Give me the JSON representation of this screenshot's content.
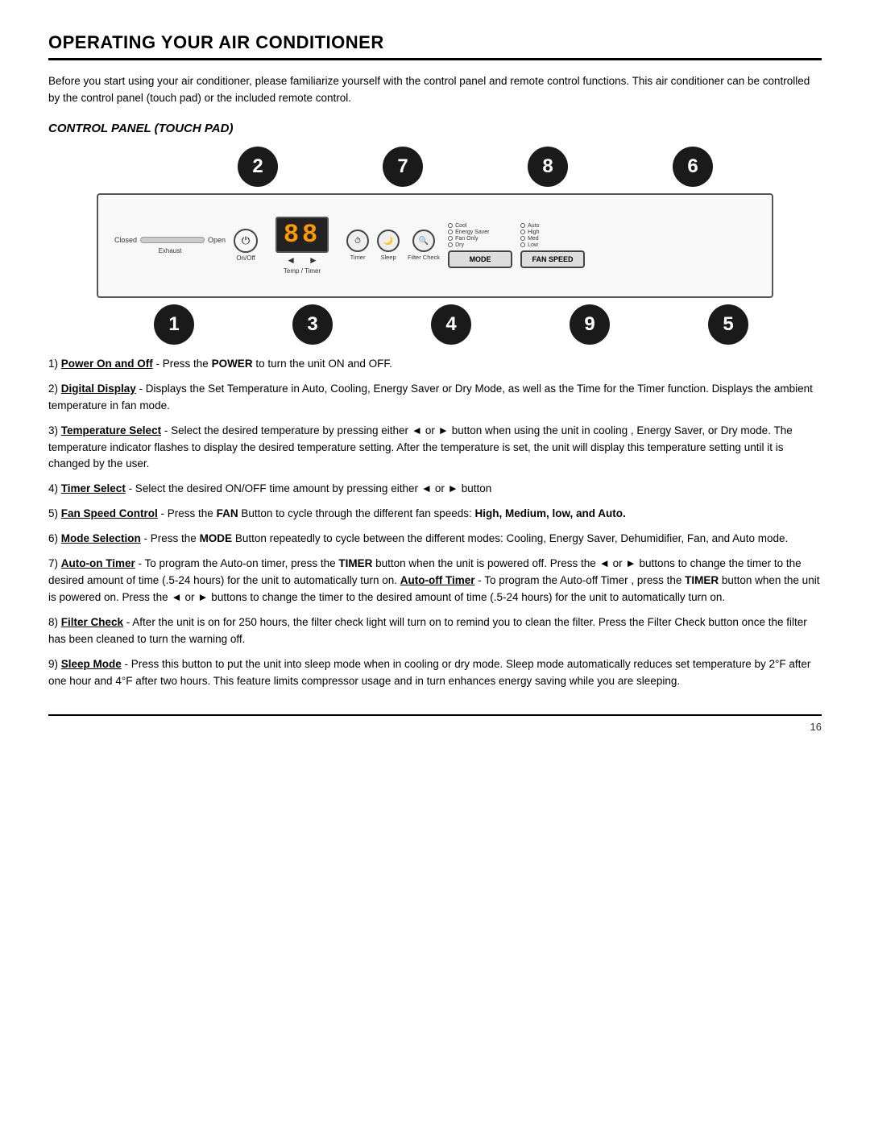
{
  "page": {
    "title": "OPERATING YOUR AIR CONDITIONER",
    "section_title": "CONTROL PANEL (TOUCH PAD)",
    "intro": "Before you start using your air conditioner, please familiarize yourself with the control panel and remote control functions. This air conditioner can be controlled by the control panel (touch pad) or the included remote control.",
    "page_number": "16"
  },
  "diagram": {
    "bubbles_top": [
      "2",
      "7",
      "8",
      "6"
    ],
    "bubbles_bottom": [
      "1",
      "3",
      "4",
      "9",
      "5"
    ],
    "panel": {
      "slider_closed": "Closed",
      "slider_open": "Open",
      "exhaust_label": "Exhaust",
      "onoff_label": "On/Off",
      "display_value": "88",
      "display_label": "Temp / Timer",
      "arrow_left": "◄",
      "arrow_right": "►",
      "timer_label": "Timer",
      "sleep_label": "Sleep",
      "filter_check_label": "Filter Check",
      "cool_label": "Cool",
      "energy_saver_label": "Energy Saver",
      "fan_only_label": "Fan Only",
      "dry_label": "Dry",
      "mode_btn": "MODE",
      "fan_speed_btn": "FAN SPEED",
      "auto_label": "Auto",
      "high_label": "High",
      "med_label": "Med",
      "low_label": "Low"
    }
  },
  "instructions": [
    {
      "number": "1",
      "label": "Power On and Off",
      "label_style": "bold",
      "text": " - Press the ",
      "keyword": "POWER",
      "rest": " to turn the unit ON and OFF."
    },
    {
      "number": "2",
      "label": "Digital Display",
      "text": " - Displays the Set Temperature in Auto, Cooling, Energy Saver or Dry Mode, as well as the Time for the Timer function. Displays the ambient temperature in fan mode."
    },
    {
      "number": "3",
      "label": "Temperature Select",
      "text": " - Select the desired temperature by pressing either ◄ or ► button when using the unit in cooling , Energy Saver, or Dry mode. The temperature indicator flashes to display the desired temperature setting. After the temperature is set, the unit will display this temperature setting until it is changed by the user."
    },
    {
      "number": "4",
      "label": "Timer Select",
      "text": " -  Select the desired ON/OFF time amount by pressing either ◄ or ► button"
    },
    {
      "number": "5",
      "label": "Fan Speed Control",
      "text": " - Press the ",
      "keyword": "FAN",
      "rest": " Button to cycle through the different fan speeds: ",
      "keyword2": "High, Medium, low, and Auto."
    },
    {
      "number": "6",
      "label": "Mode Selection",
      "text": " - Press the ",
      "keyword": "MODE",
      "rest": " Button repeatedly to cycle between the different modes: Cooling, Energy Saver, Dehumidifier, Fan, and Auto mode."
    },
    {
      "number": "7",
      "label": "Auto-on Timer",
      "text": " - To program the Auto-on timer, press the ",
      "keyword": "TIMER",
      "rest": " button when the unit is powered off. Press the ◄ or ► buttons to change the timer to the desired amount of time (.5-24 hours) for the unit to automatically turn on. ",
      "label2": "Auto-off Timer",
      "text2": " - To program the Auto-off Timer , press the ",
      "keyword2": "TIMER",
      "rest2": " button when the unit is powered on.  Press the ◄ or ► buttons to change the timer to the desired amount of time (.5-24 hours) for the unit to automatically turn on."
    },
    {
      "number": "8",
      "label": "Filter Check",
      "text": " - After the unit is on for 250 hours, the filter check light will turn on to remind you to clean the filter. Press the Filter Check button once the filter has been cleaned to turn the warning off."
    },
    {
      "number": "9",
      "label": "Sleep Mode",
      "text": " -  Press this button to put the unit into sleep mode when in cooling or dry mode. Sleep mode automatically reduces set temperature by 2°F after one hour and 4°F after two hours. This feature limits compressor usage and in turn enhances energy saving while you are sleeping."
    }
  ]
}
